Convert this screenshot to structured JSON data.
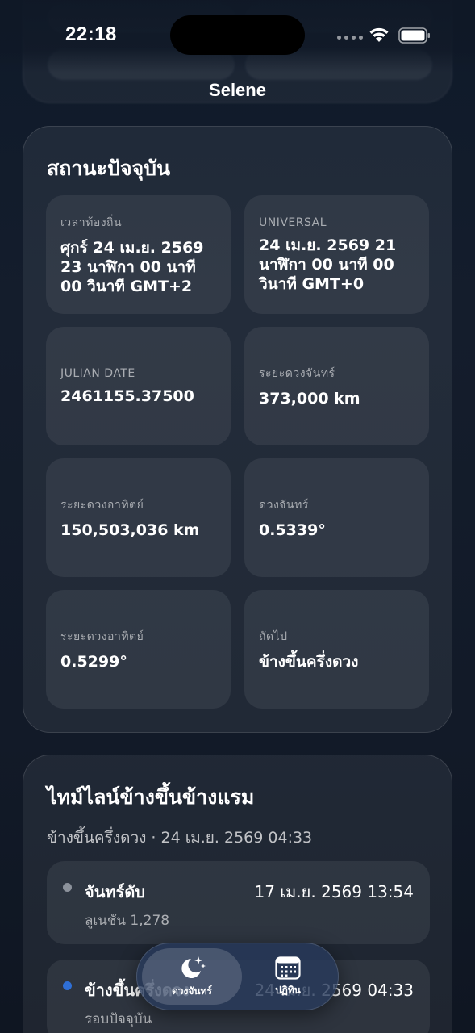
{
  "status_bar": {
    "time": "22:18"
  },
  "nav": {
    "title": "Selene"
  },
  "current_status": {
    "title": "สถานะปัจจุบัน",
    "tiles": [
      {
        "label": "เวลาท้องถิ่น",
        "value": "ศุกร์ 24 เม.ย. 2569 23 นาฬิกา 00 นาที 00 วินาที GMT+2"
      },
      {
        "label": "UNIVERSAL",
        "value": "24 เม.ย. 2569 21 นาฬิกา 00 นาที 00 วินาที GMT+0"
      },
      {
        "label": "JULIAN DATE",
        "value": "2461155.37500"
      },
      {
        "label": "ระยะดวงจันทร์",
        "value": "373,000 km"
      },
      {
        "label": "ระยะดวงอาทิตย์",
        "value": "150,503,036 km"
      },
      {
        "label": "ดวงจันทร์",
        "value": "0.5339°"
      },
      {
        "label": "ระยะดวงอาทิตย์",
        "value": "0.5299°"
      },
      {
        "label": "ถัดไป",
        "value": "ข้างขึ้นครึ่งดวง"
      }
    ]
  },
  "timeline": {
    "title": "ไทม์ไลน์ข้างขึ้นข้างแรม",
    "subtitle": "ข้างขึ้นครึ่งดวง · 24 เม.ย. 2569 04:33",
    "events": [
      {
        "name": "จันทร์ดับ",
        "time": "17 เม.ย. 2569 13:54",
        "sub": "ลูเนชัน 1,278",
        "dot_color": "#8c929b"
      },
      {
        "name": "ข้างขึ้นครึ่งดวง",
        "time": "24 เม.ย. 2569 04:33",
        "sub": "รอบปัจจุบัน",
        "dot_color": "#2f6fd6"
      }
    ]
  },
  "tab_bar": {
    "tabs": [
      {
        "label": "ดวงจันทร์",
        "icon": "moon-stars-icon",
        "active": true
      },
      {
        "label": "ปฏิทิน",
        "icon": "calendar-icon",
        "active": false
      }
    ]
  },
  "colors": {
    "background": "#121a28",
    "accent": "#2f6fd6"
  }
}
